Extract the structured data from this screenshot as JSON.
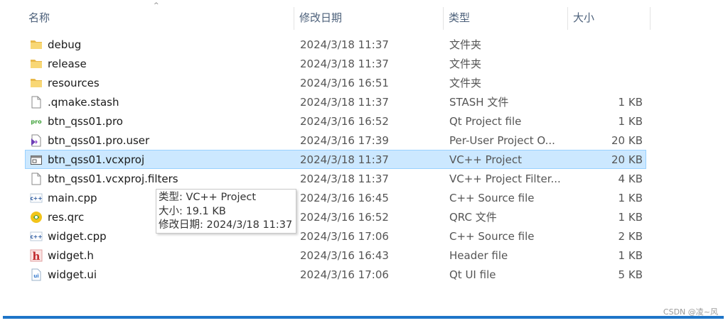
{
  "columns": {
    "name": "名称",
    "date": "修改日期",
    "type": "类型",
    "size": "大小",
    "sort_indicator": "^"
  },
  "files": [
    {
      "name": "debug",
      "date": "2024/3/18 11:37",
      "type": "文件夹",
      "size": "",
      "icon": "folder-icon"
    },
    {
      "name": "release",
      "date": "2024/3/18 11:37",
      "type": "文件夹",
      "size": "",
      "icon": "folder-icon"
    },
    {
      "name": "resources",
      "date": "2024/3/16 16:51",
      "type": "文件夹",
      "size": "",
      "icon": "folder-icon"
    },
    {
      "name": ".qmake.stash",
      "date": "2024/3/18 11:37",
      "type": "STASH 文件",
      "size": "1 KB",
      "icon": "document-icon"
    },
    {
      "name": "btn_qss01.pro",
      "date": "2024/3/16 16:52",
      "type": "Qt Project file",
      "size": "1 KB",
      "icon": "qt-pro-icon"
    },
    {
      "name": "btn_qss01.pro.user",
      "date": "2024/3/16 17:39",
      "type": "Per-User Project O...",
      "size": "20 KB",
      "icon": "visual-studio-icon"
    },
    {
      "name": "btn_qss01.vcxproj",
      "date": "2024/3/18 11:37",
      "type": "VC++ Project",
      "size": "20 KB",
      "icon": "vc-project-icon",
      "selected": true
    },
    {
      "name": "btn_qss01.vcxproj.filters",
      "date": "2024/3/18 11:37",
      "type": "VC++ Project Filter...",
      "size": "4 KB",
      "icon": "document-icon"
    },
    {
      "name": "main.cpp",
      "date": "2024/3/16 16:45",
      "type": "C++ Source file",
      "size": "1 KB",
      "icon": "cpp-file-icon"
    },
    {
      "name": "res.qrc",
      "date": "2024/3/16 16:52",
      "type": "QRC 文件",
      "size": "1 KB",
      "icon": "qrc-file-icon"
    },
    {
      "name": "widget.cpp",
      "date": "2024/3/16 17:06",
      "type": "C++ Source file",
      "size": "2 KB",
      "icon": "cpp-file-icon"
    },
    {
      "name": "widget.h",
      "date": "2024/3/16 16:43",
      "type": "Header file",
      "size": "1 KB",
      "icon": "header-file-icon"
    },
    {
      "name": "widget.ui",
      "date": "2024/3/16 17:06",
      "type": "Qt UI file",
      "size": "5 KB",
      "icon": "ui-file-icon"
    }
  ],
  "tooltip": {
    "type": "类型: VC++ Project",
    "size": "大小: 19.1 KB",
    "date": "修改日期: 2024/3/18 11:37"
  },
  "watermark": "CSDN @凌~风",
  "colors": {
    "selection_bg": "#cce8ff",
    "selection_border": "#99d1ff",
    "folder": "#f8d775",
    "accent_line": "#1e75c8"
  }
}
